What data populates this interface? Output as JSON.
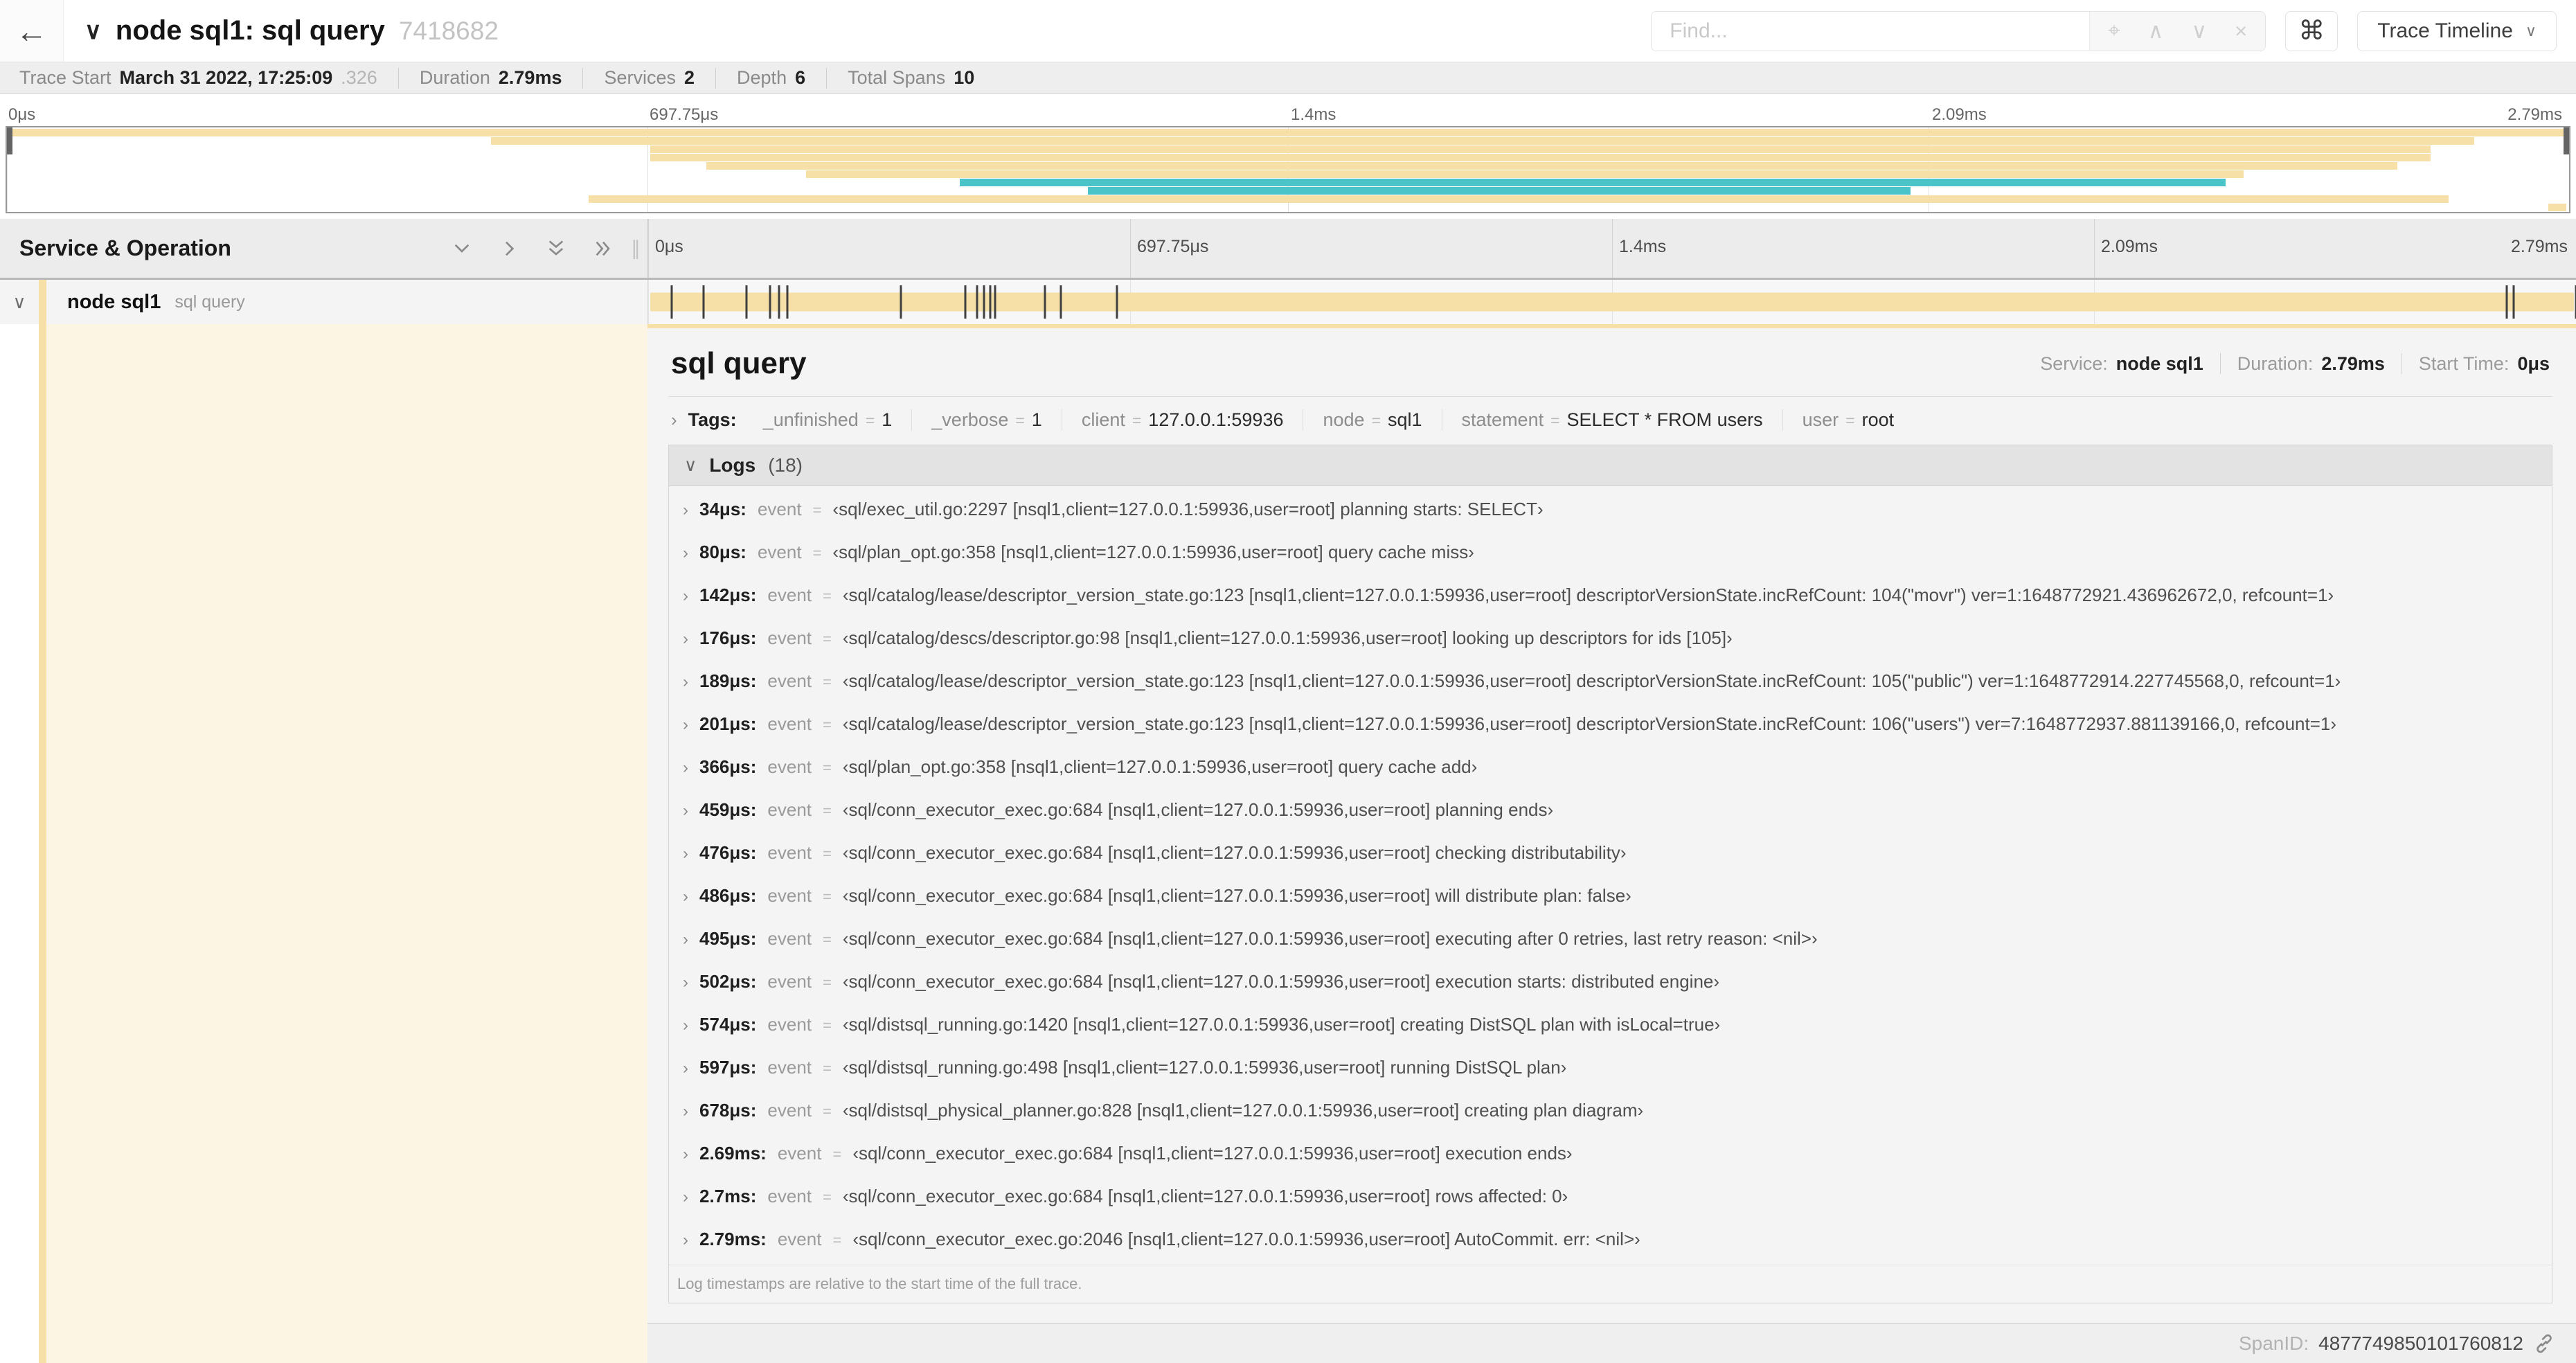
{
  "colors": {
    "tan": "#f7dfa8",
    "teal": "#4ac4c9"
  },
  "header": {
    "back_icon": "←",
    "title_chevron": "∨",
    "title": "node sql1: sql query",
    "trace_id": "7418682",
    "find_placeholder": "Find...",
    "locate_icon": "⌖",
    "prev_icon": "∧",
    "next_icon": "∨",
    "clear_icon": "×",
    "shortcut_icon": "⌘",
    "view_selector": "Trace Timeline",
    "view_chevron": "∨"
  },
  "summary": {
    "items": [
      {
        "label": "Trace Start",
        "value": "March 31 2022, 17:25:09",
        "suffix": ".326"
      },
      {
        "label": "Duration",
        "value": "2.79ms",
        "suffix": ""
      },
      {
        "label": "Services",
        "value": "2",
        "suffix": ""
      },
      {
        "label": "Depth",
        "value": "6",
        "suffix": ""
      },
      {
        "label": "Total Spans",
        "value": "10",
        "suffix": ""
      }
    ]
  },
  "timeline": {
    "total_us": 2790,
    "ticks": [
      {
        "pos": 0,
        "label": "0μs"
      },
      {
        "pos": 25,
        "label": "697.75μs"
      },
      {
        "pos": 50,
        "label": "1.4ms"
      },
      {
        "pos": 75,
        "label": "2.09ms"
      },
      {
        "pos": 100,
        "label": "2.79ms"
      }
    ],
    "left_header": "Service & Operation",
    "row": {
      "expander": "∨",
      "service": "node sql1",
      "operation": "sql query"
    }
  },
  "minimap": {
    "spans": [
      {
        "s": 0,
        "e": 100,
        "color": "tan"
      },
      {
        "s": 18.9,
        "e": 96.3,
        "color": "tan"
      },
      {
        "s": 25.1,
        "e": 94.6,
        "color": "tan"
      },
      {
        "s": 25.1,
        "e": 94.6,
        "color": "tan"
      },
      {
        "s": 27.3,
        "e": 93.3,
        "color": "tan"
      },
      {
        "s": 31.2,
        "e": 87.3,
        "color": "tan"
      },
      {
        "s": 37.2,
        "e": 86.6,
        "color": "teal"
      },
      {
        "s": 42.2,
        "e": 74.3,
        "color": "teal"
      },
      {
        "s": 22.7,
        "e": 95.3,
        "color": "tan"
      },
      {
        "s": 99.2,
        "e": 99.9,
        "color": "tan"
      }
    ]
  },
  "detail": {
    "title": "sql query",
    "meta": [
      {
        "label": "Service:",
        "value": "node sql1"
      },
      {
        "label": "Duration:",
        "value": "2.79ms"
      },
      {
        "label": "Start Time:",
        "value": "0μs"
      }
    ],
    "tags": {
      "chevron": "›",
      "label": "Tags:",
      "items": [
        {
          "key": "_unfinished",
          "value": "1"
        },
        {
          "key": "_verbose",
          "value": "1"
        },
        {
          "key": "client",
          "value": "127.0.0.1:59936"
        },
        {
          "key": "node",
          "value": "sql1"
        },
        {
          "key": "statement",
          "value": "SELECT * FROM users"
        },
        {
          "key": "user",
          "value": "root"
        }
      ]
    },
    "logs": {
      "chevron": "∨",
      "label": "Logs",
      "count": "(18)",
      "items": [
        {
          "t": 34,
          "chevron": "›",
          "time": "34μs:",
          "key": "event",
          "eq": "=",
          "value": "‹sql/exec_util.go:2297 [nsql1,client=127.0.0.1:59936,user=root] planning starts: SELECT›"
        },
        {
          "t": 80,
          "chevron": "›",
          "time": "80μs:",
          "key": "event",
          "eq": "=",
          "value": "‹sql/plan_opt.go:358 [nsql1,client=127.0.0.1:59936,user=root] query cache miss›"
        },
        {
          "t": 142,
          "chevron": "›",
          "time": "142μs:",
          "key": "event",
          "eq": "=",
          "value": "‹sql/catalog/lease/descriptor_version_state.go:123 [nsql1,client=127.0.0.1:59936,user=root] descriptorVersionState.incRefCount: 104(\"movr\") ver=1:1648772921.436962672,0, refcount=1›"
        },
        {
          "t": 176,
          "chevron": "›",
          "time": "176μs:",
          "key": "event",
          "eq": "=",
          "value": "‹sql/catalog/descs/descriptor.go:98 [nsql1,client=127.0.0.1:59936,user=root] looking up descriptors for ids [105]›"
        },
        {
          "t": 189,
          "chevron": "›",
          "time": "189μs:",
          "key": "event",
          "eq": "=",
          "value": "‹sql/catalog/lease/descriptor_version_state.go:123 [nsql1,client=127.0.0.1:59936,user=root] descriptorVersionState.incRefCount: 105(\"public\") ver=1:1648772914.227745568,0, refcount=1›"
        },
        {
          "t": 201,
          "chevron": "›",
          "time": "201μs:",
          "key": "event",
          "eq": "=",
          "value": "‹sql/catalog/lease/descriptor_version_state.go:123 [nsql1,client=127.0.0.1:59936,user=root] descriptorVersionState.incRefCount: 106(\"users\") ver=7:1648772937.881139166,0, refcount=1›"
        },
        {
          "t": 366,
          "chevron": "›",
          "time": "366μs:",
          "key": "event",
          "eq": "=",
          "value": "‹sql/plan_opt.go:358 [nsql1,client=127.0.0.1:59936,user=root] query cache add›"
        },
        {
          "t": 459,
          "chevron": "›",
          "time": "459μs:",
          "key": "event",
          "eq": "=",
          "value": "‹sql/conn_executor_exec.go:684 [nsql1,client=127.0.0.1:59936,user=root] planning ends›"
        },
        {
          "t": 476,
          "chevron": "›",
          "time": "476μs:",
          "key": "event",
          "eq": "=",
          "value": "‹sql/conn_executor_exec.go:684 [nsql1,client=127.0.0.1:59936,user=root] checking distributability›"
        },
        {
          "t": 486,
          "chevron": "›",
          "time": "486μs:",
          "key": "event",
          "eq": "=",
          "value": "‹sql/conn_executor_exec.go:684 [nsql1,client=127.0.0.1:59936,user=root] will distribute plan: false›"
        },
        {
          "t": 495,
          "chevron": "›",
          "time": "495μs:",
          "key": "event",
          "eq": "=",
          "value": "‹sql/conn_executor_exec.go:684 [nsql1,client=127.0.0.1:59936,user=root] executing after 0 retries, last retry reason: <nil>›"
        },
        {
          "t": 502,
          "chevron": "›",
          "time": "502μs:",
          "key": "event",
          "eq": "=",
          "value": "‹sql/conn_executor_exec.go:684 [nsql1,client=127.0.0.1:59936,user=root] execution starts: distributed engine›"
        },
        {
          "t": 574,
          "chevron": "›",
          "time": "574μs:",
          "key": "event",
          "eq": "=",
          "value": "‹sql/distsql_running.go:1420 [nsql1,client=127.0.0.1:59936,user=root] creating DistSQL plan with isLocal=true›"
        },
        {
          "t": 597,
          "chevron": "›",
          "time": "597μs:",
          "key": "event",
          "eq": "=",
          "value": "‹sql/distsql_running.go:498 [nsql1,client=127.0.0.1:59936,user=root] running DistSQL plan›"
        },
        {
          "t": 678,
          "chevron": "›",
          "time": "678μs:",
          "key": "event",
          "eq": "=",
          "value": "‹sql/distsql_physical_planner.go:828 [nsql1,client=127.0.0.1:59936,user=root] creating plan diagram›"
        },
        {
          "t": 2690,
          "chevron": "›",
          "time": "2.69ms:",
          "key": "event",
          "eq": "=",
          "value": "‹sql/conn_executor_exec.go:684 [nsql1,client=127.0.0.1:59936,user=root] execution ends›"
        },
        {
          "t": 2700,
          "chevron": "›",
          "time": "2.7ms:",
          "key": "event",
          "eq": "=",
          "value": "‹sql/conn_executor_exec.go:684 [nsql1,client=127.0.0.1:59936,user=root] rows affected: 0›"
        },
        {
          "t": 2790,
          "chevron": "›",
          "time": "2.79ms:",
          "key": "event",
          "eq": "=",
          "value": "‹sql/conn_executor_exec.go:2046 [nsql1,client=127.0.0.1:59936,user=root] AutoCommit. err: <nil>›"
        }
      ],
      "footnote": "Log timestamps are relative to the start time of the full trace."
    },
    "footer": {
      "label": "SpanID:",
      "value": "4877749850101760812"
    }
  }
}
